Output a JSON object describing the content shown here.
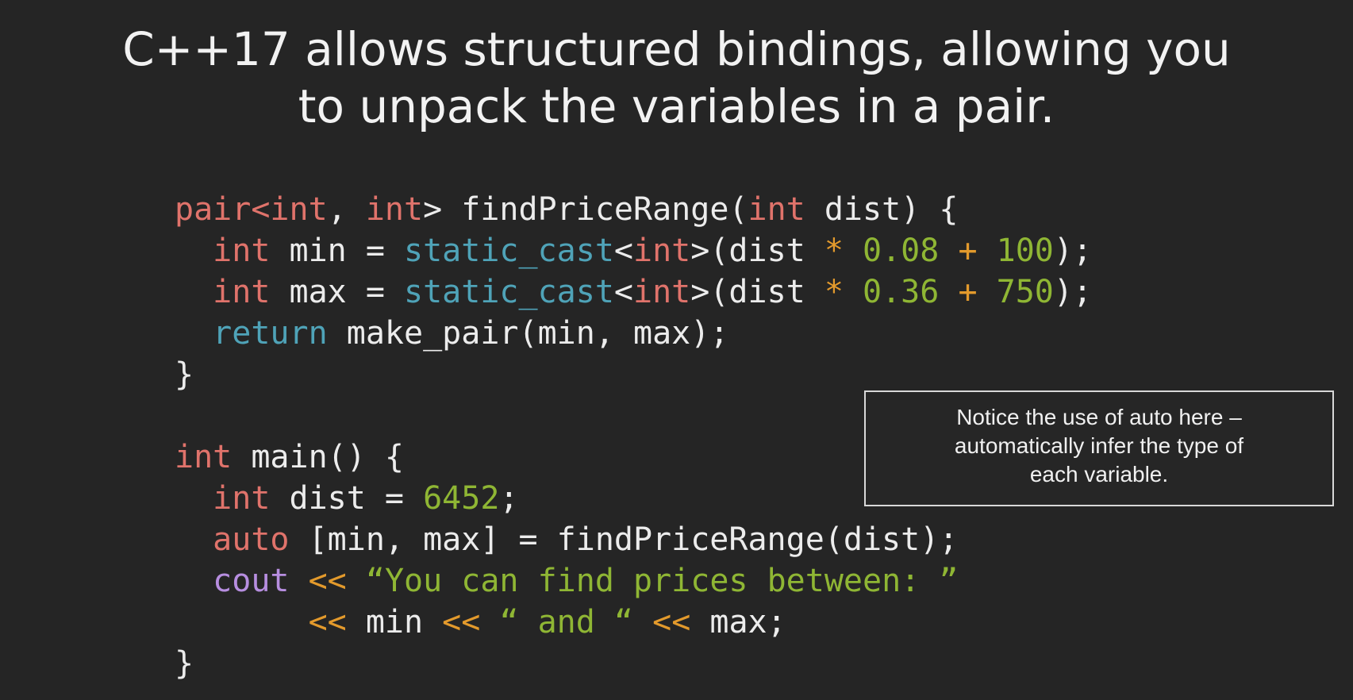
{
  "slide": {
    "title_line1": "C++17 allows structured bindings, allowing you",
    "title_line2": "to unpack the variables in a pair.",
    "note_line1": "Notice the use of auto here –",
    "note_line2": "automatically infer the type of",
    "note_line3": "each variable."
  },
  "code_lines": [
    [
      {
        "t": "pair<",
        "c": "red"
      },
      {
        "t": "int",
        "c": "red"
      },
      {
        "t": ", ",
        "c": "white"
      },
      {
        "t": "int",
        "c": "red"
      },
      {
        "t": "> findPriceRange(",
        "c": "white"
      },
      {
        "t": "int",
        "c": "red"
      },
      {
        "t": " dist) {",
        "c": "white"
      }
    ],
    [
      {
        "t": "  ",
        "c": "white"
      },
      {
        "t": "int",
        "c": "red"
      },
      {
        "t": " min = ",
        "c": "white"
      },
      {
        "t": "static_cast",
        "c": "teal"
      },
      {
        "t": "<",
        "c": "white"
      },
      {
        "t": "int",
        "c": "red"
      },
      {
        "t": ">(dist ",
        "c": "white"
      },
      {
        "t": "*",
        "c": "orange"
      },
      {
        "t": " ",
        "c": "white"
      },
      {
        "t": "0.08",
        "c": "green"
      },
      {
        "t": " ",
        "c": "white"
      },
      {
        "t": "+",
        "c": "orange"
      },
      {
        "t": " ",
        "c": "white"
      },
      {
        "t": "100",
        "c": "green"
      },
      {
        "t": ");",
        "c": "white"
      }
    ],
    [
      {
        "t": "  ",
        "c": "white"
      },
      {
        "t": "int",
        "c": "red"
      },
      {
        "t": " max = ",
        "c": "white"
      },
      {
        "t": "static_cast",
        "c": "teal"
      },
      {
        "t": "<",
        "c": "white"
      },
      {
        "t": "int",
        "c": "red"
      },
      {
        "t": ">(dist ",
        "c": "white"
      },
      {
        "t": "*",
        "c": "orange"
      },
      {
        "t": " ",
        "c": "white"
      },
      {
        "t": "0.36",
        "c": "green"
      },
      {
        "t": " ",
        "c": "white"
      },
      {
        "t": "+",
        "c": "orange"
      },
      {
        "t": " ",
        "c": "white"
      },
      {
        "t": "750",
        "c": "green"
      },
      {
        "t": ");",
        "c": "white"
      }
    ],
    [
      {
        "t": "  ",
        "c": "white"
      },
      {
        "t": "return",
        "c": "teal"
      },
      {
        "t": " make_pair(min, max);",
        "c": "white"
      }
    ],
    [
      {
        "t": "}",
        "c": "white"
      }
    ],
    [],
    [
      {
        "t": "int",
        "c": "red"
      },
      {
        "t": " main() {",
        "c": "white"
      }
    ],
    [
      {
        "t": "  ",
        "c": "white"
      },
      {
        "t": "int",
        "c": "red"
      },
      {
        "t": " dist = ",
        "c": "white"
      },
      {
        "t": "6452",
        "c": "green"
      },
      {
        "t": ";",
        "c": "white"
      }
    ],
    [
      {
        "t": "  ",
        "c": "white"
      },
      {
        "t": "auto",
        "c": "red"
      },
      {
        "t": " [min, max] = findPriceRange(dist);",
        "c": "white"
      }
    ],
    [
      {
        "t": "  ",
        "c": "white"
      },
      {
        "t": "cout",
        "c": "purple"
      },
      {
        "t": " ",
        "c": "white"
      },
      {
        "t": "<<",
        "c": "orange"
      },
      {
        "t": " ",
        "c": "white"
      },
      {
        "t": "“You can find prices between: ”",
        "c": "green"
      }
    ],
    [
      {
        "t": "       ",
        "c": "white"
      },
      {
        "t": "<<",
        "c": "orange"
      },
      {
        "t": " min ",
        "c": "white"
      },
      {
        "t": "<<",
        "c": "orange"
      },
      {
        "t": " ",
        "c": "white"
      },
      {
        "t": "“ and “",
        "c": "green"
      },
      {
        "t": " ",
        "c": "white"
      },
      {
        "t": "<<",
        "c": "orange"
      },
      {
        "t": " max;",
        "c": "white"
      }
    ],
    [
      {
        "t": "}",
        "c": "white"
      }
    ]
  ],
  "colors": {
    "background": "#252525",
    "keyword_red": "#e0736b",
    "keyword_teal": "#4fa3b8",
    "keyword_purple": "#b78ee0",
    "operator_orange": "#e39a2c",
    "literal_green": "#8fb634",
    "text_white": "#ececec"
  }
}
